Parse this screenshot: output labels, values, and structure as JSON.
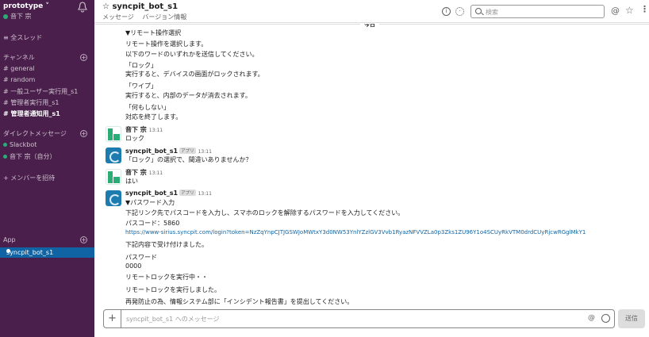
{
  "workspace": {
    "name": "prototype",
    "user": "音下 宗"
  },
  "sidebar": {
    "threads": "全スレッド",
    "channels_heading": "チャンネル",
    "channels": [
      "# general",
      "# random",
      "# 一般ユーザー実行用_s1",
      "# 管理者実行用_s1",
      "# 管理者通知用_s1"
    ],
    "dm_heading": "ダイレクトメッセージ",
    "dms": [
      "Slackbot",
      "音下 宗（自分）"
    ],
    "invite": "+ メンバーを招待",
    "app_heading": "App",
    "apps": [
      "syncpit_bot_s1"
    ]
  },
  "header": {
    "channel_name": "syncpit_bot_s1",
    "tabs": [
      "メッセージ",
      "バージョン情報"
    ],
    "search_placeholder": "検索"
  },
  "messages": {
    "date_divider": "今日",
    "first_block": [
      "▼リモート操作選択",
      "リモート操作を選択します。",
      "以下のワードのいずれかを送信してください。",
      "「ロック」",
      "実行すると、デバイスの画面がロックされます。",
      "「ワイプ」",
      "実行すると、内部のデータが消去されます。",
      "「何もしない」",
      "対応を終了します。"
    ],
    "m1": {
      "name": "音下 宗",
      "time": "13:11",
      "text": "ロック"
    },
    "m2": {
      "name": "syncpit_bot_s1",
      "badge": "アプリ",
      "time": "13:11",
      "text": "「ロック」の選択で、間違いありませんか？"
    },
    "m3": {
      "name": "音下 宗",
      "time": "13:11",
      "text": "はい"
    },
    "m4": {
      "name": "syncpit_bot_s1",
      "badge": "アプリ",
      "time": "13:11",
      "lines": [
        "▼パスワード入力",
        "下記リンク先でパスコードを入力し、スマホのロックを解除するパスワードを入力してください。",
        "パスコード：5860"
      ],
      "link": "https://www-sirius.syncpit.com/login?token=NzZqYnpCJTJGSWJoMWtxY3d0NW53YnlYZzlGV3Vvb1RyazNFVVZLa0p3Zks1ZU96Y1o4SCUyRkVTM0drdCUyRjcwRGglMkY1",
      "after": [
        "下記内容で受け付けました。",
        "パスワード",
        "0000",
        "リモートロックを実行中・・",
        "リモートロックを実行しました。",
        "再発防止の為、情報システム部に「インシデント報告書」を提出してください。"
      ]
    }
  },
  "composer": {
    "placeholder": "syncpit_bot_s1 へのメッセージ",
    "send_label": "送信"
  }
}
